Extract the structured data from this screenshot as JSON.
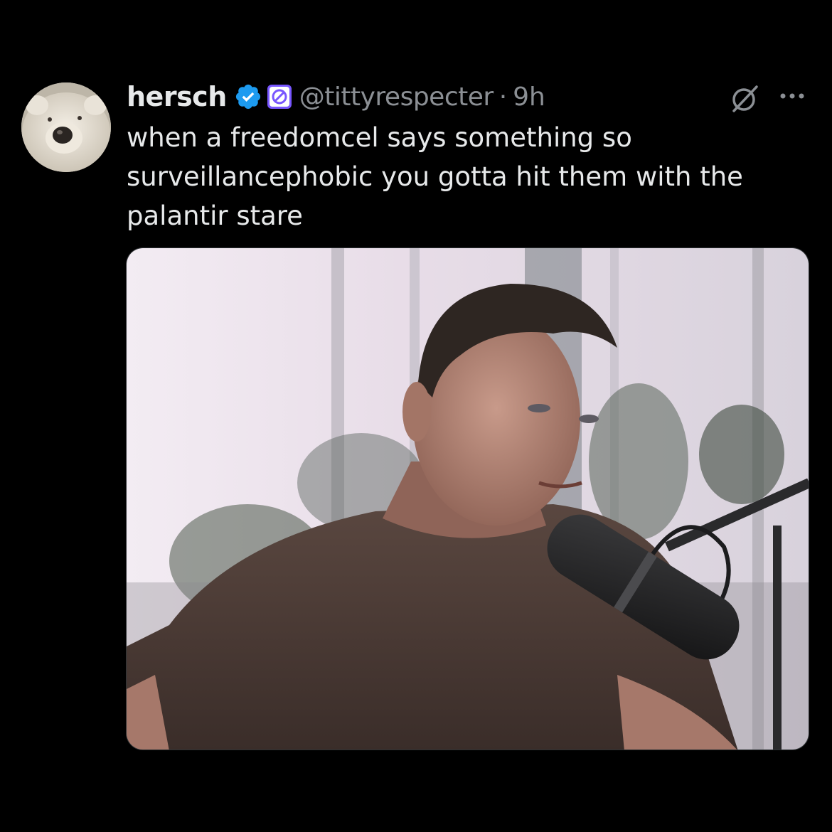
{
  "tweet": {
    "display_name": "hersch",
    "handle": "@tittyrespecter",
    "separator": "·",
    "timestamp": "9h",
    "text": "when a freedomcel says something so\nsurveillancephobic you gotta hit them with the\npalantir stare",
    "avatar_icon": "polar-bear-avatar",
    "verified_icon": "verified-badge-icon",
    "affiliate_icon": "affiliate-badge-icon",
    "action_icons": [
      "grok-icon",
      "more-icon"
    ],
    "media": {
      "type": "photo",
      "subject": "man-with-microphone-photo"
    }
  },
  "colors": {
    "background": "#000000",
    "primary_text": "#e7e9ea",
    "secondary_text": "#8b8f94",
    "verified_blue": "#1d9bf0",
    "affiliate_purple": "#7856ff"
  }
}
